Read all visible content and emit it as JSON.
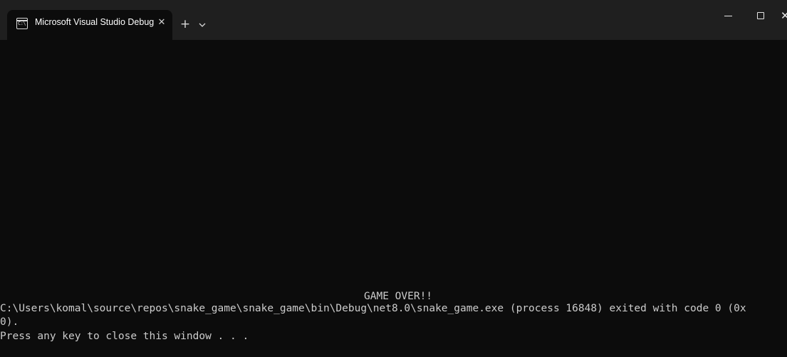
{
  "window": {
    "tab": {
      "title": "Microsoft Visual Studio Debug Console",
      "icon": "console-app-icon",
      "icon_glyph": "C:\\",
      "close_glyph": "✕"
    },
    "new_tab_glyph": "+",
    "dropdown_icon": "chevron-down-icon",
    "controls": {
      "minimize_icon": "minimize-icon",
      "maximize_icon": "maximize-icon",
      "close_icon": "close-icon",
      "close_glyph": "✕"
    },
    "colors": {
      "background": "#0c0c0c",
      "titlebar": "#1f1f1f",
      "text": "#cccccc"
    }
  },
  "console": {
    "lines": [
      "GAME OVER!!",
      "C:\\Users\\komal\\source\\repos\\snake_game\\snake_game\\bin\\Debug\\net8.0\\snake_game.exe (process 16848) exited with code 0 (0x",
      "0).",
      "Press any key to close this window . . ."
    ]
  }
}
